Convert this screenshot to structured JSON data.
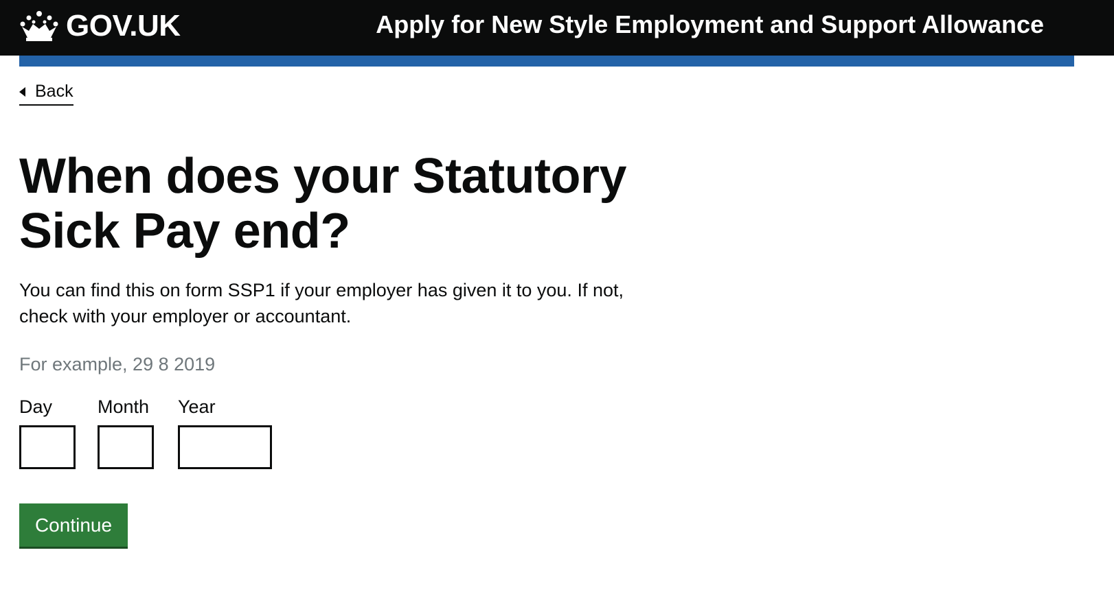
{
  "header": {
    "logo_text": "GOV.UK",
    "logo_icon": "crown-icon",
    "service_name": "Apply for New Style Employment and Support Allowance"
  },
  "back_link": {
    "label": "Back",
    "icon": "chevron-left-icon"
  },
  "main": {
    "heading_line1": "When does your Statutory",
    "heading_line2": "Sick Pay end?",
    "body_line1": "You can find this on form SSP1 if your employer has given it to you. If not,",
    "body_line2": "check with your employer or accountant.",
    "hint": "For example, 29 8 2019"
  },
  "date_input": {
    "day_label": "Day",
    "day_value": "",
    "month_label": "Month",
    "month_value": "",
    "year_label": "Year",
    "year_value": ""
  },
  "actions": {
    "continue_label": "Continue"
  },
  "colors": {
    "header_bg": "#0b0c0c",
    "header_bar": "#2463a8",
    "button_green": "#2e7d3a",
    "hint_grey": "#6f777b"
  }
}
